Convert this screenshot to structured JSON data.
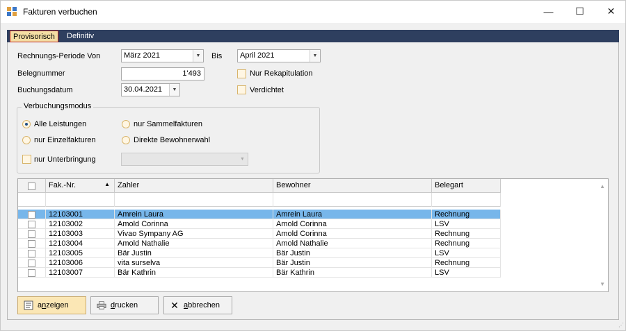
{
  "window": {
    "title": "Fakturen verbuchen",
    "controls": {
      "minimize": "—",
      "maximize": "☐",
      "close": "✕"
    }
  },
  "tabs": [
    {
      "label": "Provisorisch",
      "active": true
    },
    {
      "label": "Definitiv",
      "active": false
    }
  ],
  "form": {
    "period_from_label": "Rechnungs-Periode Von",
    "period_from_value": "März 2021",
    "period_to_label": "Bis",
    "period_to_value": "April 2021",
    "belegnummer_label": "Belegnummer",
    "belegnummer_value": "1'493",
    "buchungsdatum_label": "Buchungsdatum",
    "buchungsdatum_value": "30.04.2021",
    "nur_rekap_label": "Nur Rekapitulation",
    "verdichtet_label": "Verdichtet"
  },
  "verbuchungsmodus": {
    "title": "Verbuchungsmodus",
    "options": [
      {
        "label": "Alle Leistungen",
        "selected": true
      },
      {
        "label": "nur Sammelfakturen",
        "selected": false
      },
      {
        "label": "nur Einzelfakturen",
        "selected": false
      },
      {
        "label": "Direkte Bewohnerwahl",
        "selected": false
      }
    ],
    "nur_unterbringung_label": "nur Unterbringung"
  },
  "grid": {
    "columns": [
      "Fak.-Nr.",
      "Zahler",
      "Bewohner",
      "Belegart"
    ],
    "rows": [
      {
        "nr": "12103001",
        "zahler": "Amrein Laura",
        "bewohner": "Amrein Laura",
        "belegart": "Rechnung",
        "selected": true
      },
      {
        "nr": "12103002",
        "zahler": "Amold Corinna",
        "bewohner": "Amold Corinna",
        "belegart": "LSV",
        "selected": false
      },
      {
        "nr": "12103003",
        "zahler": "Vivao Sympany AG",
        "bewohner": "Amold Corinna",
        "belegart": "Rechnung",
        "selected": false
      },
      {
        "nr": "12103004",
        "zahler": "Amold Nathalie",
        "bewohner": "Amold Nathalie",
        "belegart": "Rechnung",
        "selected": false
      },
      {
        "nr": "12103005",
        "zahler": "Bär Justin",
        "bewohner": "Bär Justin",
        "belegart": "LSV",
        "selected": false
      },
      {
        "nr": "12103006",
        "zahler": "vita surselva",
        "bewohner": "Bär Justin",
        "belegart": "Rechnung",
        "selected": false
      },
      {
        "nr": "12103007",
        "zahler": "Bär Kathrin",
        "bewohner": "Bär Kathrin",
        "belegart": "LSV",
        "selected": false
      }
    ]
  },
  "buttons": {
    "anzeigen": {
      "first": "a",
      "under": "n",
      "rest": "zeigen"
    },
    "drucken": {
      "under": "d",
      "rest": "rucken"
    },
    "abbrechen": {
      "under": "a",
      "rest": "bbrechen"
    }
  },
  "colors": {
    "tabbar": "#2e3f5f",
    "selected_row": "#77b6ea",
    "primary_button": "#fbe7b5"
  }
}
